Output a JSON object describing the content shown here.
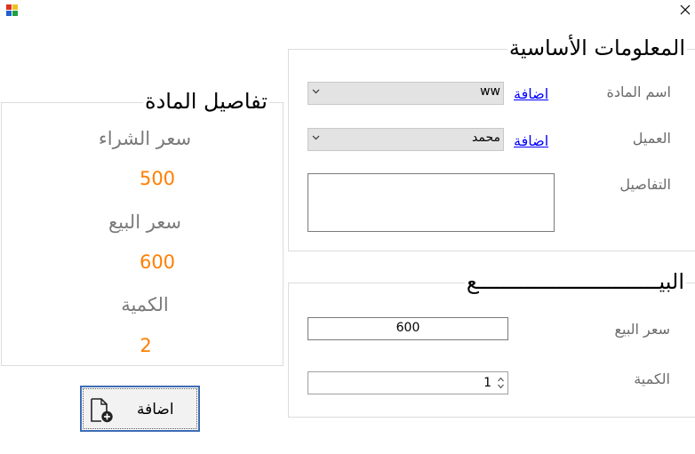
{
  "window": {
    "app_icon": "winforms-app-icon",
    "close_icon": "close-icon",
    "close_symbol": "✕"
  },
  "basic_info": {
    "title": "المعلومات الأساسية",
    "material_name_label": "اسم المادة",
    "material_value": "ww",
    "material_add_link": "اضافة",
    "customer_label": "العميل",
    "customer_value": "محمد",
    "customer_add_link": "اضافة",
    "details_label": "التفاصيل",
    "details_value": ""
  },
  "sale": {
    "title": "البيـــــــــــــــــــــــــــــع",
    "sale_price_label": "سعر البيع",
    "sale_price_value": "600",
    "quantity_label": "الكمية",
    "quantity_value": "1"
  },
  "material_details": {
    "title": "تفاصيل المادة",
    "purchase_price_label": "سعر الشراء",
    "purchase_price_value": "500",
    "sale_price_label": "سعر البيع",
    "sale_price_value": "600",
    "quantity_label": "الكمية",
    "quantity_value": "2"
  },
  "add_button": {
    "label": "اضافة",
    "icon": "add-document-icon"
  },
  "colors": {
    "accent_orange": "#ff7f00",
    "link_blue": "#0000ff",
    "button_border": "#3c6cb4"
  }
}
